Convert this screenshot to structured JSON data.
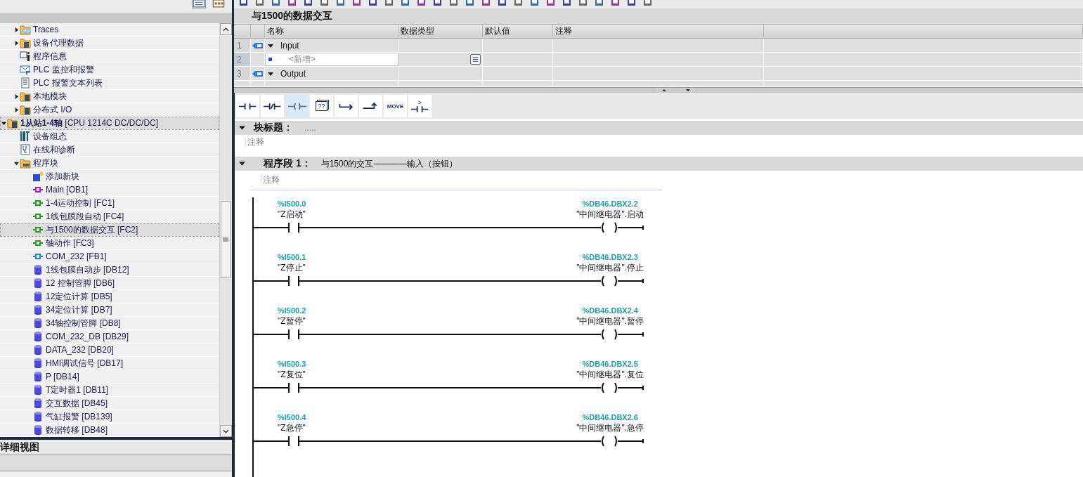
{
  "tree": {
    "above": [
      {
        "label": "Traces",
        "kind": "traces",
        "expanded": false,
        "selected": false
      },
      {
        "label": "设备代理数据",
        "kind": "proxy",
        "expanded": false,
        "selected": false
      },
      {
        "label": "程序信息",
        "kind": "info",
        "selected": false
      },
      {
        "label": "PLC 监控和报警",
        "kind": "alarm",
        "selected": false
      },
      {
        "label": "PLC 报警文本列表",
        "kind": "textlist",
        "selected": false
      },
      {
        "label": "本地模块",
        "kind": "module",
        "expanded": false,
        "selected": false
      },
      {
        "label": "分布式 I/O",
        "kind": "module",
        "expanded": false,
        "selected": false
      }
    ],
    "nodes": [
      {
        "label": "**1从站1-4轴** [CPU 1214C DC/DC/DC]",
        "kind": "module",
        "expanded": true,
        "selected": true,
        "children": [
          {
            "label": "设备组态",
            "kind": "config",
            "selected": false
          },
          {
            "label": "在线和诊断",
            "kind": "diag",
            "selected": false
          },
          {
            "label": "程序块",
            "kind": "blocks",
            "expanded": true,
            "selected": false,
            "children": [
              {
                "label": "添加新块",
                "kind": "add",
                "selected": false
              },
              {
                "label": "Main [OB1]",
                "kind": "ob",
                "selected": false
              },
              {
                "label": "1-4运动控制 [FC1]",
                "kind": "fc",
                "selected": false
              },
              {
                "label": "1线包膜段自动 [FC4]",
                "kind": "fc",
                "selected": false
              },
              {
                "label": "与1500的数据交互 [FC2]",
                "kind": "fc",
                "selected": true
              },
              {
                "label": "轴动作 [FC3]",
                "kind": "fc",
                "selected": false
              },
              {
                "label": "COM_232 [FB1]",
                "kind": "fb",
                "selected": false
              },
              {
                "label": "1线包膜自动步 [DB12]",
                "kind": "db",
                "selected": false
              },
              {
                "label": "12 控制管脚 [DB6]",
                "kind": "db",
                "selected": false
              },
              {
                "label": "12定位计算 [DB5]",
                "kind": "db",
                "selected": false
              },
              {
                "label": "34定位计算 [DB7]",
                "kind": "db",
                "selected": false
              },
              {
                "label": "34轴控制管脚 [DB8]",
                "kind": "db",
                "selected": false
              },
              {
                "label": "COM_232_DB [DB29]",
                "kind": "db",
                "selected": false
              },
              {
                "label": "DATA_232 [DB20]",
                "kind": "db",
                "selected": false
              },
              {
                "label": "HMI调试信号 [DB17]",
                "kind": "db",
                "selected": false
              },
              {
                "label": "P [DB14]",
                "kind": "db",
                "selected": false
              },
              {
                "label": "T定时器1 [DB11]",
                "kind": "db",
                "selected": false
              },
              {
                "label": "交互数据 [DB45]",
                "kind": "db",
                "selected": false
              },
              {
                "label": "气缸报警 [DB139]",
                "kind": "db",
                "selected": false
              },
              {
                "label": "数据转移 [DB48]",
                "kind": "db",
                "selected": false
              }
            ]
          }
        ]
      }
    ]
  },
  "detail_view": {
    "title": "详细视图"
  },
  "block": {
    "title": "与1500的数据交互"
  },
  "interface": {
    "columns": [
      "名称",
      "数据类型",
      "默认值",
      "注释"
    ],
    "rows": [
      {
        "number": "1",
        "kind": "section",
        "expanded": true,
        "name": "Input",
        "selected": false
      },
      {
        "number": "2",
        "kind": "new",
        "name": "<新增>",
        "selected": true
      },
      {
        "number": "3",
        "kind": "section",
        "expanded": true,
        "name": "Output",
        "selected": false
      }
    ]
  },
  "lad_tools": [
    {
      "kind": "no-contact",
      "selected": false
    },
    {
      "kind": "nc-contact",
      "selected": false
    },
    {
      "kind": "coil",
      "selected": true
    },
    {
      "kind": "box",
      "label": "??",
      "selected": false
    },
    {
      "kind": "branch-open",
      "selected": false
    },
    {
      "kind": "branch-close",
      "selected": false
    },
    {
      "kind": "text",
      "label": "MOVE",
      "selected": false
    },
    {
      "kind": "compare",
      "label": ">",
      "selected": false
    }
  ],
  "block_header": {
    "label": "块标题：",
    "value": ".....",
    "comment": "注释",
    "expanded": true
  },
  "network": {
    "label": "程序段 1：",
    "title": "与1500的交互————输入（按钮）",
    "comment": "注释",
    "expanded": true,
    "rungs": [
      {
        "contact_address": "%I500.0",
        "contact_symbol": "\"Z启动\"",
        "coil_address": "%DB46.DBX2.2",
        "coil_symbol": "\"中间继电器\".启动"
      },
      {
        "contact_address": "%I500.1",
        "contact_symbol": "\"Z停止\"",
        "coil_address": "%DB46.DBX2.3",
        "coil_symbol": "\"中间继电器\".停止"
      },
      {
        "contact_address": "%I500.2",
        "contact_symbol": "\"Z暂停\"",
        "coil_address": "%DB46.DBX2.4",
        "coil_symbol": "\"中间继电器\".暂停"
      },
      {
        "contact_address": "%I500.3",
        "contact_symbol": "\"Z复位\"",
        "coil_address": "%DB46.DBX2.5",
        "coil_symbol": "\"中间继电器\".复位"
      },
      {
        "contact_address": "%I500.4",
        "contact_symbol": "\"Z急停\"",
        "coil_address": "%DB46.DBX2.6",
        "coil_symbol": "\"中间继电器\".急停"
      }
    ]
  }
}
